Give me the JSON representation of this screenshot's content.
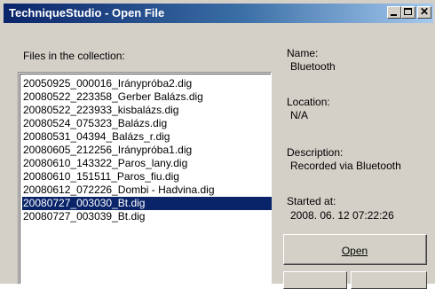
{
  "window": {
    "title": "TechniqueStudio - Open File",
    "controls": {
      "minimize": "_",
      "maximize": "□",
      "close": "✕"
    }
  },
  "files": {
    "label": "Files in the collection:",
    "items": [
      "20050925_000016_Iránypróba2.dig",
      "20080522_223358_Gerber Balázs.dig",
      "20080522_223933_kisbalázs.dig",
      "20080524_075323_Balázs.dig",
      "20080531_04394_Balázs_r.dig",
      "20080605_212256_Iránypróba1.dig",
      "20080610_143322_Paros_lany.dig",
      "20080610_151511_Paros_fiu.dig",
      "20080612_072226_Dombi - Hadvina.dig",
      "20080727_003030_Bt.dig",
      "20080727_003039_Bt.dig"
    ],
    "selected_index": 9
  },
  "details": {
    "name_label": "Name:",
    "name_value": "Bluetooth",
    "location_label": "Location:",
    "location_value": "N/A",
    "description_label": "Description:",
    "description_value": "Recorded via Bluetooth",
    "started_label": "Started at:",
    "started_value": "2008. 06. 12 07:22:26"
  },
  "buttons": {
    "open_label": "Open"
  }
}
